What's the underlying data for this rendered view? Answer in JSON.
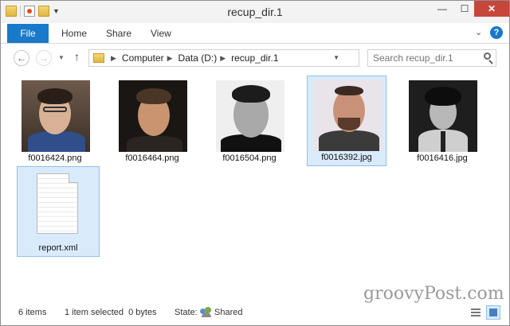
{
  "window": {
    "title": "recup_dir.1"
  },
  "titlebar_buttons": {
    "minimize": "—",
    "maximize": "☐",
    "close": "✕"
  },
  "ribbon": {
    "tabs": [
      {
        "label": "File",
        "active": true
      },
      {
        "label": "Home"
      },
      {
        "label": "Share"
      },
      {
        "label": "View"
      }
    ],
    "help": "?"
  },
  "address": {
    "path": [
      "Computer",
      "Data (D:)",
      "recup_dir.1"
    ]
  },
  "search": {
    "placeholder": "Search recup_dir.1"
  },
  "files": [
    {
      "name": "f0016424.png",
      "selected": false
    },
    {
      "name": "f0016464.png",
      "selected": false
    },
    {
      "name": "f0016504.png",
      "selected": false
    },
    {
      "name": "f0016392.jpg",
      "selected": true
    },
    {
      "name": "f0016416.jpg",
      "selected": false
    },
    {
      "name": "report.xml",
      "selected": true
    }
  ],
  "status": {
    "count": "6 items",
    "selection": "1 item selected  0 bytes",
    "state_label": "State:",
    "state_value": "Shared"
  },
  "watermark": "groovyPost.com",
  "colors": {
    "accent": "#1979ca",
    "close": "#c7463b",
    "selection": "#d9ebfb"
  }
}
